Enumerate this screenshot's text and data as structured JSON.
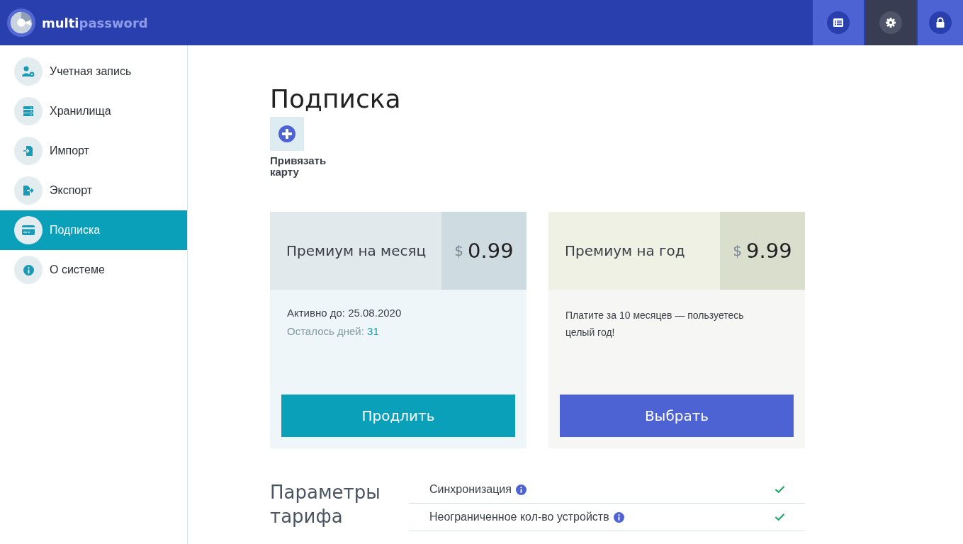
{
  "app": {
    "logo_bold": "multi",
    "logo_light": "password"
  },
  "header_buttons": [
    {
      "selected": false
    },
    {
      "selected": true
    },
    {
      "selected": false
    }
  ],
  "sidebar": {
    "items": [
      {
        "label": "Учетная запись",
        "selected": false
      },
      {
        "label": "Хранилища",
        "selected": false
      },
      {
        "label": "Импорт",
        "selected": false
      },
      {
        "label": "Экспорт",
        "selected": false
      },
      {
        "label": "Подписка",
        "selected": true
      },
      {
        "label": "О системе",
        "selected": false
      }
    ]
  },
  "page": {
    "title": "Подписка",
    "add_card_label": "Привязать карту"
  },
  "plans": [
    {
      "kind": "current",
      "name": "Премиум на месяц",
      "currency": "$",
      "price": "0.99",
      "active_until": "Активно до: 25.08.2020",
      "days_left_label": "Осталось дней:",
      "days_left": "31",
      "button": "Продлить"
    },
    {
      "kind": "offer",
      "name": "Премиум на год",
      "currency": "$",
      "price": "9.99",
      "description": "Платите за 10 месяцев — пользуетесь целый год!",
      "button": "Выбрать"
    }
  ],
  "features": {
    "title": "Параметры тарифа",
    "rows": [
      {
        "label": "Синхронизация",
        "included": true
      },
      {
        "label": "Неограниченное кол-во устройств",
        "included": true
      }
    ]
  }
}
